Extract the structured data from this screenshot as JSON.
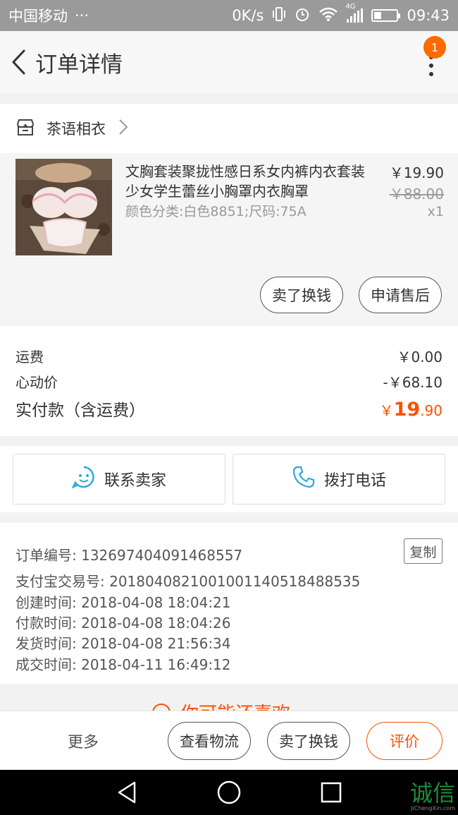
{
  "status_bar": {
    "carrier": "中国移动",
    "dots": "···",
    "net_speed": "0K/s",
    "network_type": "4G",
    "time": "09:43",
    "icons": [
      "vibrate-icon",
      "alarm-icon",
      "wifi-icon",
      "signal-icon",
      "battery-icon"
    ]
  },
  "header": {
    "title": "订单详情",
    "badge_count": "1"
  },
  "shop": {
    "name": "茶语相衣"
  },
  "product": {
    "title": "文胸套装聚拢性感日系女内裤内衣套装少女学生蕾丝小胸罩内衣胸罩",
    "spec": "颜色分类:白色8851;尺码:75A",
    "price": "￥19.90",
    "original_price": "￥88.00",
    "quantity": "x1",
    "actions": [
      "卖了换钱",
      "申请售后"
    ]
  },
  "fees": {
    "shipping_label": "运费",
    "shipping_value": "￥0.00",
    "discount_label": "心动价",
    "discount_value": "-￥68.10",
    "total_label": "实付款（含运费）",
    "total_currency": "￥",
    "total_int": "19",
    "total_dec": ".90"
  },
  "contact": {
    "seller_label": "联系卖家",
    "call_label": "拨打电话"
  },
  "order_info": {
    "copy_label": "复制",
    "lines": [
      "订单编号: 132697404091468557",
      "支付宝交易号: 2018040821001001140518488535",
      "创建时间: 2018-04-08 18:04:21",
      "付款时间: 2018-04-08 18:04:26",
      "发货时间: 2018-04-08 21:56:34",
      "成交时间: 2018-04-11 16:49:12"
    ]
  },
  "peek_text": "你可能还喜欢",
  "action_bar": {
    "more": "更多",
    "logistics": "查看物流",
    "resell": "卖了换钱",
    "review": "评价"
  },
  "watermark": {
    "text": "诚信",
    "sub": "JiChengXin.com"
  },
  "colors": {
    "accent": "#ff5000",
    "badge": "#ff6a00",
    "status_bar": "#9a9a9a"
  }
}
